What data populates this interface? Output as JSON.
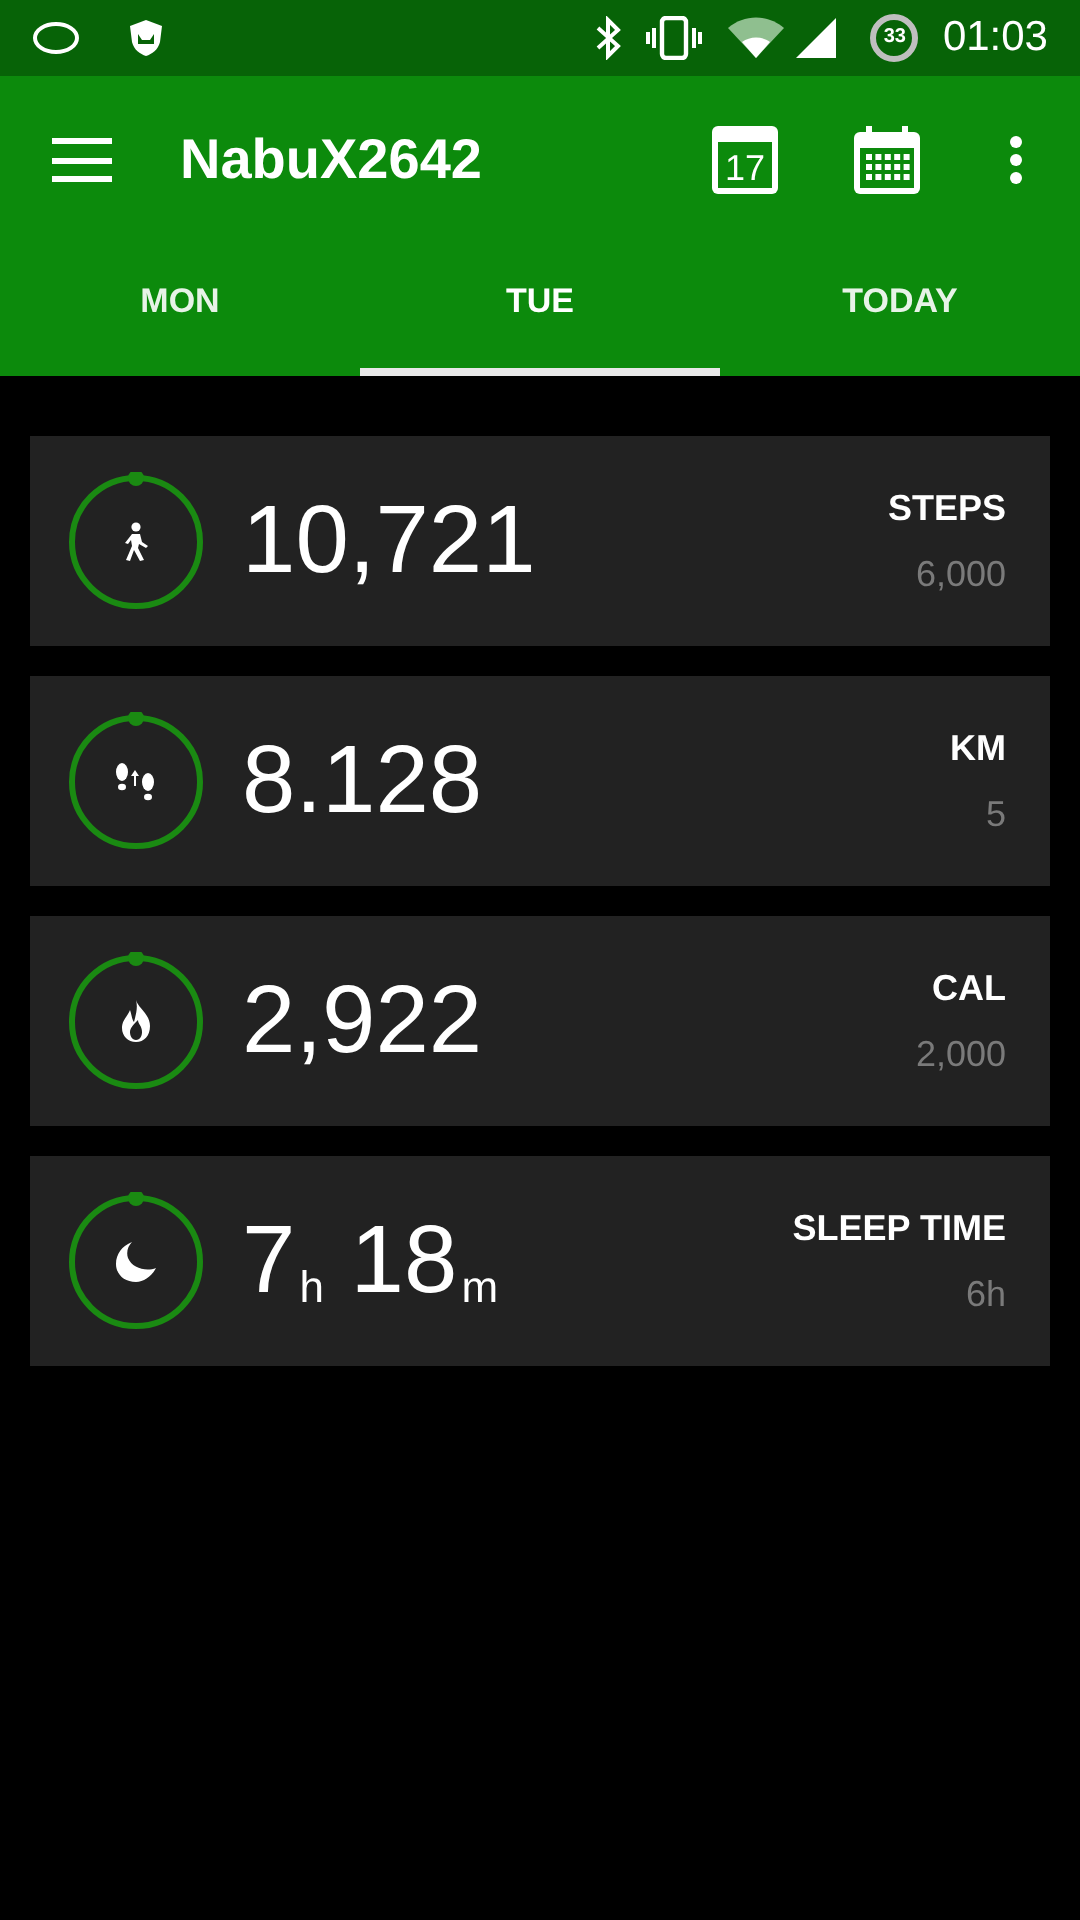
{
  "status_bar": {
    "battery": "33",
    "time": "01:03"
  },
  "toolbar": {
    "title": "NabuX2642",
    "calendar_day": "17"
  },
  "tabs": [
    {
      "label": "MON",
      "selected": false
    },
    {
      "label": "TUE",
      "selected": true
    },
    {
      "label": "TODAY",
      "selected": false
    }
  ],
  "metrics": [
    {
      "kind": "steps",
      "value": "10,721",
      "label": "STEPS",
      "goal": "6,000"
    },
    {
      "kind": "distance",
      "value": "8.128",
      "label": "KM",
      "goal": "5"
    },
    {
      "kind": "calories",
      "value": "2,922",
      "label": "CAL",
      "goal": "2,000"
    },
    {
      "kind": "sleep",
      "value": "7$_{h}$ 18$_{m}$",
      "label": "SLEEP TIME",
      "goal": "6h"
    }
  ]
}
